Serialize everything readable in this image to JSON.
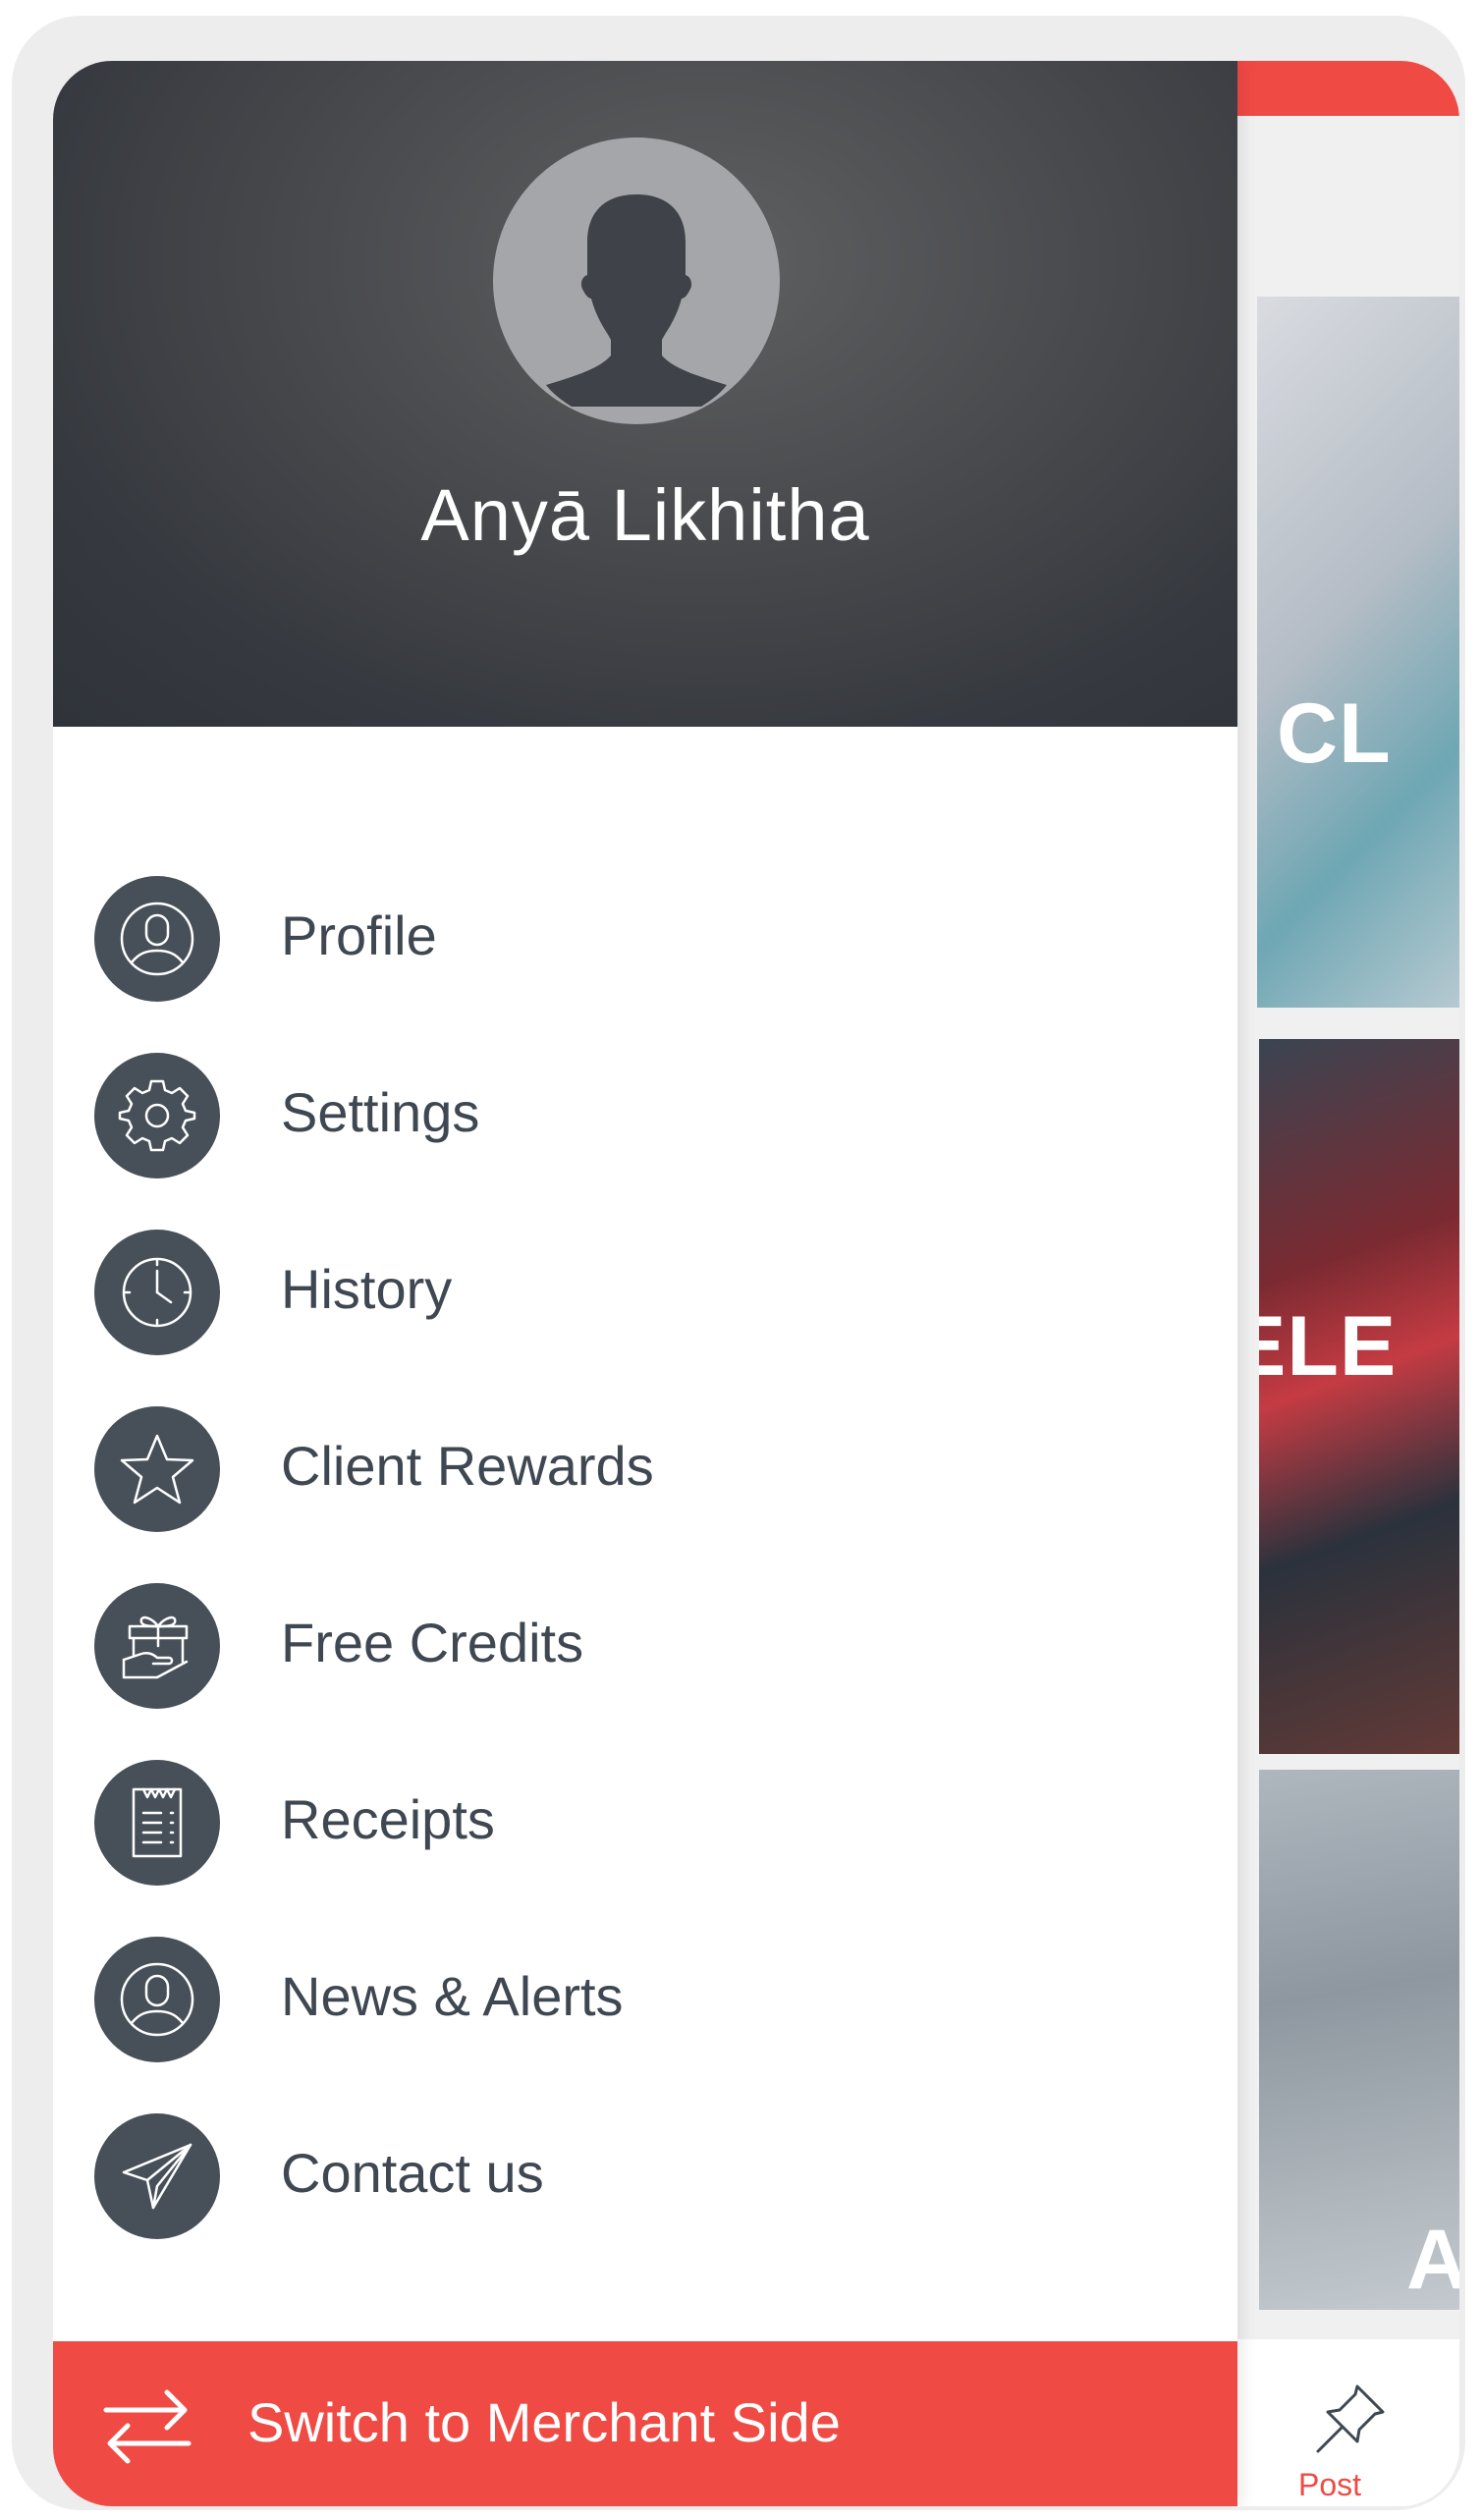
{
  "user": {
    "name": "Anyā Likhitha"
  },
  "menu": {
    "items": [
      {
        "label": "Profile",
        "icon": "profile-icon"
      },
      {
        "label": "Settings",
        "icon": "gear-icon"
      },
      {
        "label": "History",
        "icon": "clock-icon"
      },
      {
        "label": "Client Rewards",
        "icon": "star-icon"
      },
      {
        "label": "Free Credits",
        "icon": "gift-icon"
      },
      {
        "label": "Receipts",
        "icon": "receipt-icon"
      },
      {
        "label": "News & Alerts",
        "icon": "profile-icon"
      },
      {
        "label": "Contact us",
        "icon": "paper-plane-icon"
      }
    ]
  },
  "switch_bar": {
    "label": "Switch to Merchant Side",
    "icon": "swap-arrows-icon"
  },
  "background": {
    "cards": [
      {
        "title": "CL"
      },
      {
        "title": "ELE"
      },
      {
        "title": "A"
      }
    ],
    "tab": {
      "label": "Post",
      "icon": "pin-icon"
    }
  },
  "colors": {
    "accent": "#f04a45",
    "header_dark": "#36393f",
    "icon_circle": "#475058",
    "text": "#3f4852"
  }
}
